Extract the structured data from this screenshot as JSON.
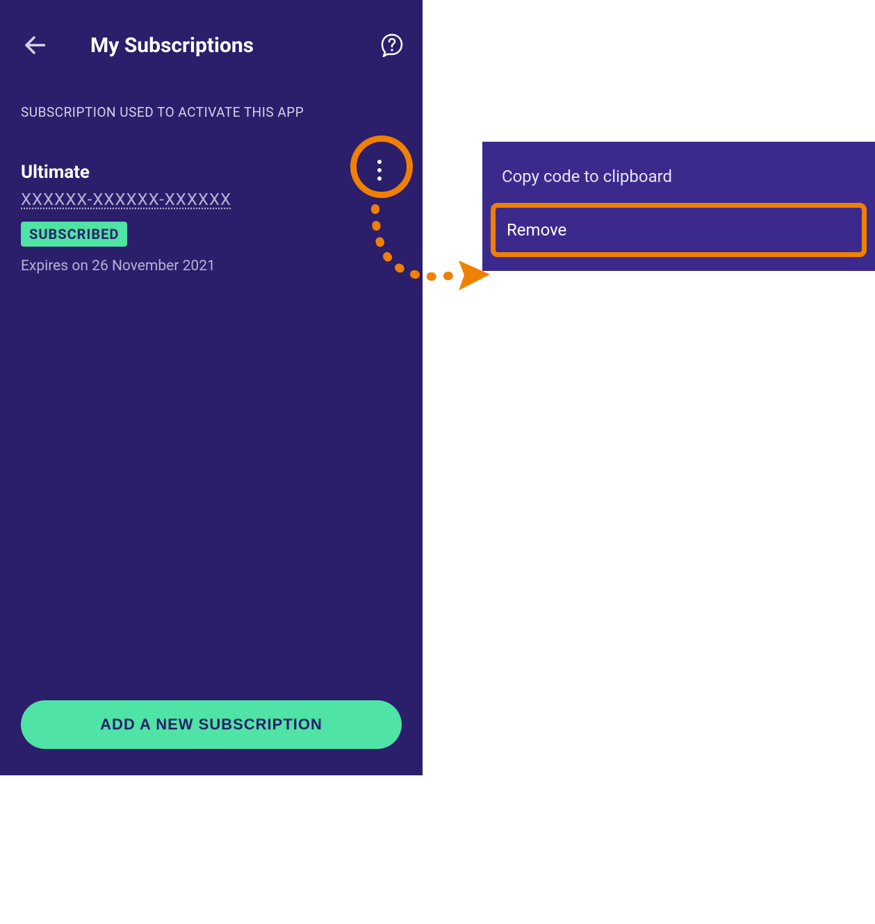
{
  "header": {
    "title": "My Subscriptions"
  },
  "section_label": "SUBSCRIPTION USED TO ACTIVATE THIS APP",
  "subscription": {
    "plan": "Ultimate",
    "code": "XXXXXX-XXXXXX-XXXXXX",
    "status_badge": "SUBSCRIBED",
    "expires": "Expires on 26 November 2021"
  },
  "add_button": "ADD A NEW SUBSCRIPTION",
  "popup": {
    "copy": "Copy code to clipboard",
    "remove": "Remove"
  },
  "colors": {
    "panel_bg": "#2b1e6b",
    "popup_bg": "#3b2a8c",
    "accent_green": "#4fe3a5",
    "highlight_orange": "#f08000"
  }
}
